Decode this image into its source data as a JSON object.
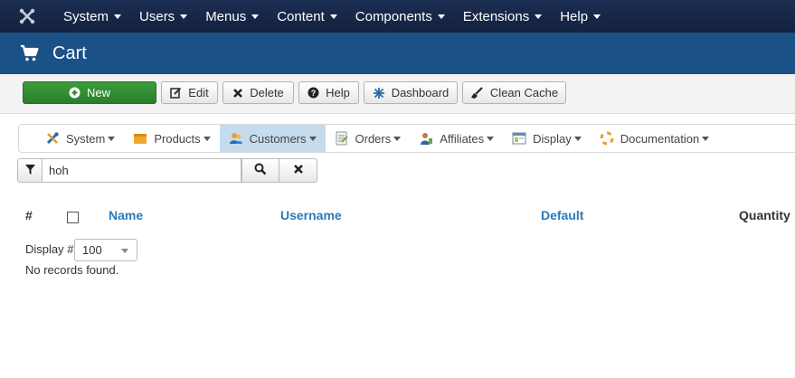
{
  "topnav": {
    "items": [
      "System",
      "Users",
      "Menus",
      "Content",
      "Components",
      "Extensions",
      "Help"
    ]
  },
  "header": {
    "title": "Cart"
  },
  "toolbar": {
    "new_label": "New",
    "edit_label": "Edit",
    "delete_label": "Delete",
    "help_label": "Help",
    "dashboard_label": "Dashboard",
    "clean_cache_label": "Clean Cache",
    "new_color": "#2e8b2e"
  },
  "component_menu": {
    "items": [
      "System",
      "Products",
      "Customers",
      "Orders",
      "Affiliates",
      "Display",
      "Documentation"
    ],
    "active": "Customers",
    "active_color": "#c5dcef"
  },
  "search": {
    "value": "hoh"
  },
  "table": {
    "columns": [
      "#",
      "Name",
      "Username",
      "Default",
      "Quantity"
    ],
    "link_color": "#2a7ab8"
  },
  "pagination": {
    "display_label": "Display #",
    "display_value": "100"
  },
  "status": {
    "empty_message": "No records found."
  }
}
